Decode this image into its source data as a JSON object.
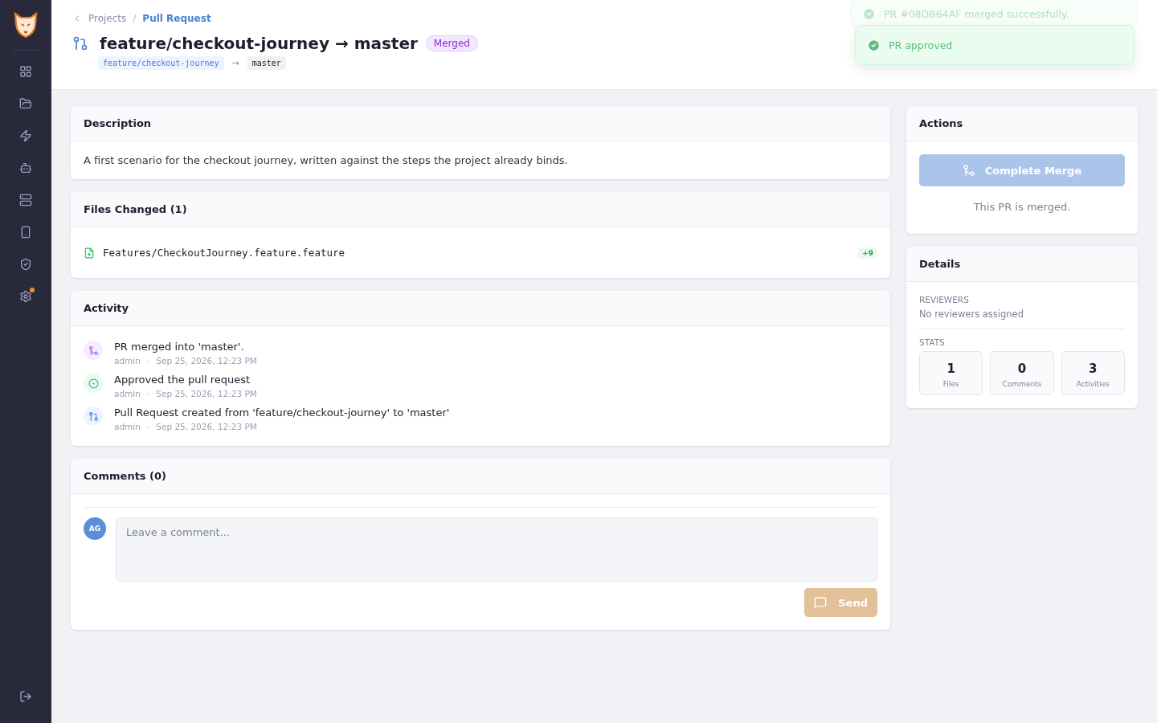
{
  "sidebar": {
    "items": [
      {
        "kind": "dashboard",
        "selected": false
      },
      {
        "kind": "projects",
        "selected": false
      },
      {
        "kind": "actions",
        "selected": false
      },
      {
        "kind": "bot",
        "selected": false
      },
      {
        "kind": "servers",
        "selected": false
      },
      {
        "kind": "devices",
        "selected": false
      },
      {
        "kind": "security",
        "selected": false
      },
      {
        "kind": "settings",
        "selected": false,
        "badge": true
      }
    ]
  },
  "breadcrumb_separator": "/",
  "breadcrumb": [
    {
      "label": "Projects",
      "selected": false
    },
    {
      "label": "Pull Request",
      "selected": true
    }
  ],
  "header": {
    "title": "feature/checkout-journey → master",
    "status": "Merged",
    "source_branch": "feature/checkout-journey",
    "arrow": "→",
    "target_branch": "master"
  },
  "toasts": [
    {
      "message": "PR #08DB64AF merged successfully.",
      "fading": true
    },
    {
      "message": "PR approved",
      "fading": false
    }
  ],
  "description": {
    "title": "Description",
    "text": "A first scenario for the checkout journey, written against the steps the project already binds."
  },
  "files_changed": {
    "title": "Files Changed (1)",
    "files": [
      {
        "path": "Features/CheckoutJourney.feature.feature",
        "additions": "+9"
      }
    ]
  },
  "activity": {
    "title": "Activity",
    "items": [
      {
        "kind": "merged",
        "text": "PR merged into 'master'.",
        "user": "admin",
        "separator": "·",
        "time": "Sep 25, 2026, 12:23 PM"
      },
      {
        "kind": "approved",
        "text": "Approved the pull request",
        "user": "admin",
        "separator": "·",
        "time": "Sep 25, 2026, 12:23 PM"
      },
      {
        "kind": "created",
        "text": "Pull Request created from 'feature/checkout-journey' to 'master'",
        "user": "admin",
        "separator": "·",
        "time": "Sep 25, 2026, 12:23 PM"
      }
    ]
  },
  "comments": {
    "title": "Comments (0)",
    "avatar": "AG",
    "placeholder": "Leave a comment...",
    "send": "Send",
    "send_disabled": true
  },
  "actions": {
    "title": "Actions",
    "button": "Complete Merge",
    "button_disabled": true,
    "note": "This PR is merged."
  },
  "details": {
    "title": "Details",
    "reviewers_label": "REVIEWERS",
    "reviewers": "No reviewers assigned",
    "stats_label": "STATS",
    "stats": [
      {
        "value": "1",
        "label": "Files"
      },
      {
        "value": "0",
        "label": "Comments"
      },
      {
        "value": "3",
        "label": "Activities"
      }
    ]
  }
}
